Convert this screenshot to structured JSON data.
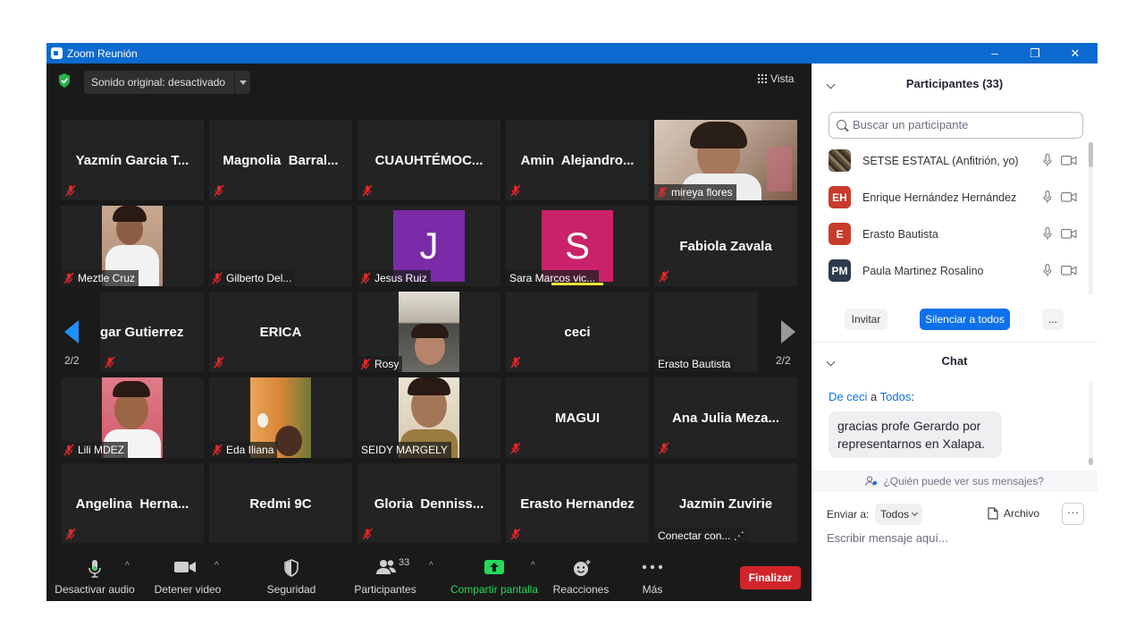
{
  "window": {
    "title": "Zoom Reunión",
    "controls": [
      "–",
      "❐",
      "✕"
    ]
  },
  "video": {
    "original_sound": "Sonido original: desactivado",
    "view_label": "Vista",
    "page_left": "2/2",
    "page_right": "2/2",
    "tiles": [
      {
        "name": "Yazmín Garcia T...",
        "type": "name"
      },
      {
        "name": "Magnolia  Barral...",
        "type": "name"
      },
      {
        "name": "CUAUHTÉMOC...",
        "type": "name"
      },
      {
        "name": "Amin  Alejandro...",
        "type": "name"
      },
      {
        "name": "mireya flores",
        "type": "video"
      },
      {
        "name": "Meztle Cruz",
        "type": "video"
      },
      {
        "name": "Gilberto  Del...",
        "type": "label"
      },
      {
        "name": "Jesus Ruiz",
        "type": "avatar",
        "letter": "J"
      },
      {
        "name": "Sara Marcos vic...",
        "type": "avatar",
        "letter": "S"
      },
      {
        "name": "Fabiola Zavala",
        "type": "name"
      },
      {
        "name": "gar Gutierrez",
        "type": "name"
      },
      {
        "name": "ERICA",
        "type": "name"
      },
      {
        "name": "Rosy",
        "type": "video"
      },
      {
        "name": "ceci",
        "type": "name"
      },
      {
        "name": "Erasto Bautista",
        "type": "label"
      },
      {
        "name": "Lili MDEZ",
        "type": "video"
      },
      {
        "name": "Eda Iliana",
        "type": "video"
      },
      {
        "name": "SEIDY MARGELY",
        "type": "video"
      },
      {
        "name": "MAGUI",
        "type": "name"
      },
      {
        "name": "Ana Julia Meza...",
        "type": "name"
      },
      {
        "name": "Angelina  Herna...",
        "type": "name"
      },
      {
        "name": "Redmi 9C",
        "type": "name"
      },
      {
        "name": "Gloria  Denniss...",
        "type": "name"
      },
      {
        "name": "Erasto Hernandez",
        "type": "name"
      },
      {
        "name": "Jazmin Zuvirie",
        "type": "name",
        "sub": "Conectar con... ⋰"
      }
    ]
  },
  "toolbar": {
    "mute_audio": "Desactivar audio",
    "stop_video": "Detener video",
    "security": "Seguridad",
    "participants": "Participantes",
    "participants_count": "33",
    "share_screen": "Compartir pantalla",
    "reactions": "Reacciones",
    "more": "Más",
    "end": "Finalizar"
  },
  "participants_panel": {
    "title": "Participantes (33)",
    "search_placeholder": "Buscar un participante",
    "list": [
      {
        "initials": "",
        "name": "SETSE ESTATAL (Anfitrión, yo)",
        "color": "#5a4a35"
      },
      {
        "initials": "EH",
        "name": "Enrique Hernández Hernández",
        "color": "#c93a2c"
      },
      {
        "initials": "E",
        "name": "Erasto Bautista",
        "color": "#c93a2c"
      },
      {
        "initials": "PM",
        "name": "Paula Martinez Rosalino",
        "color": "#2d3a4f"
      }
    ],
    "invite": "Invitar",
    "mute_all": "Silenciar a todos",
    "more": "..."
  },
  "chat": {
    "title": "Chat",
    "from_prefix": "De",
    "from_user": "ceci",
    "to_word": "a",
    "to_target": "Todos",
    "message": "gracias profe Gerardo por representarnos en Xalapa.",
    "who_can_see": "¿Quién puede ver sus mensajes?",
    "send_to_label": "Enviar a:",
    "send_to_value": "Todos",
    "file_label": "Archivo",
    "input_placeholder": "Escribir mensaje aquí..."
  },
  "colors": {
    "titlebar": "#0b6bd0",
    "accent": "#0e71eb",
    "end_button": "#d1242a",
    "share_green": "#23d959",
    "muted_red": "#e02828"
  }
}
